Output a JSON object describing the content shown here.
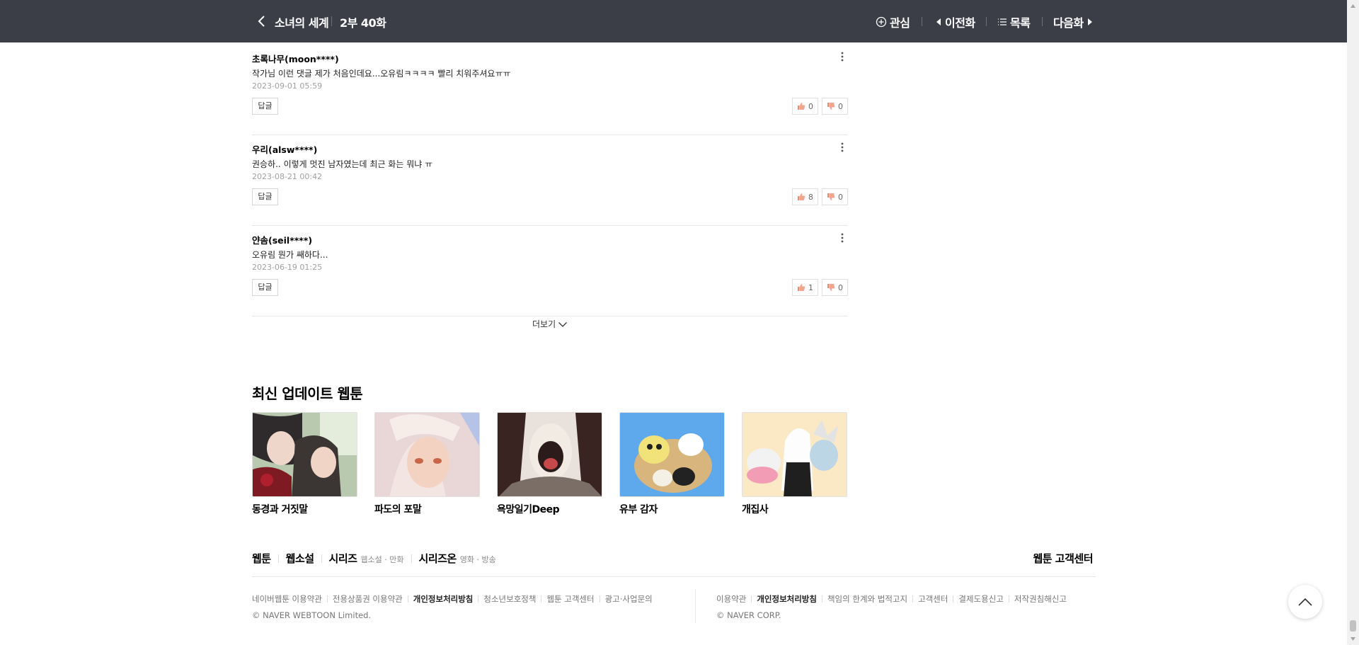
{
  "header": {
    "title": "소녀의 세계",
    "episode": "2부 40화",
    "interest_label": "관심",
    "prev_label": "이전화",
    "list_label": "목록",
    "next_label": "다음화"
  },
  "comments": [
    {
      "author": "초록나무(moon****)",
      "text": "작가님 이런 댓글 제가 처음인데요...오유림ㅋㅋㅋㅋ 빨리 치워주셔요ㅠㅠ",
      "date": "2023-09-01 05:59",
      "reply": "답글",
      "likes": "0",
      "dislikes": "0"
    },
    {
      "author": "우리(alsw****)",
      "text": "권승하.. 이렇게 멋진 남자였는데 최근 화는 뭐냐 ㅠ",
      "date": "2023-08-21 00:42",
      "reply": "답글",
      "likes": "8",
      "dislikes": "0"
    },
    {
      "author": "얀솜(seil****)",
      "text": "오유림 뭔가 쌔하다...",
      "date": "2023-06-19 01:25",
      "reply": "답글",
      "likes": "1",
      "dislikes": "0"
    }
  ],
  "load_more": "더보기",
  "latest": {
    "title": "최신 업데이트 웹툰",
    "items": [
      {
        "name": "동경과 거짓말"
      },
      {
        "name": "파도의 포말"
      },
      {
        "name": "욕망일기Deep"
      },
      {
        "name": "유부 감자"
      },
      {
        "name": "개집사"
      }
    ]
  },
  "footer": {
    "nav": [
      {
        "label": "웹툰",
        "sub": ""
      },
      {
        "label": "웹소설",
        "sub": ""
      },
      {
        "label": "시리즈",
        "sub": "웹소설 · 만화"
      },
      {
        "label": "시리즈온",
        "sub": "영화 · 방송"
      }
    ],
    "help_center": "웹툰 고객센터",
    "left_links": [
      "네이버웹툰 이용약관",
      "전용상품권 이용약관",
      "개인정보처리방침",
      "청소년보호정책",
      "웹툰 고객센터",
      "광고·사업문의"
    ],
    "left_copyright": "© NAVER WEBTOON Limited.",
    "right_links": [
      "이용약관",
      "개인정보처리방침",
      "책임의 한계와 법적고지",
      "고객센터",
      "결제도용신고",
      "저작권침해신고"
    ],
    "right_copyright": "© NAVER CORP."
  },
  "colors": {
    "header_bg": "#3c3e47",
    "text_muted": "#a0a0a0"
  }
}
